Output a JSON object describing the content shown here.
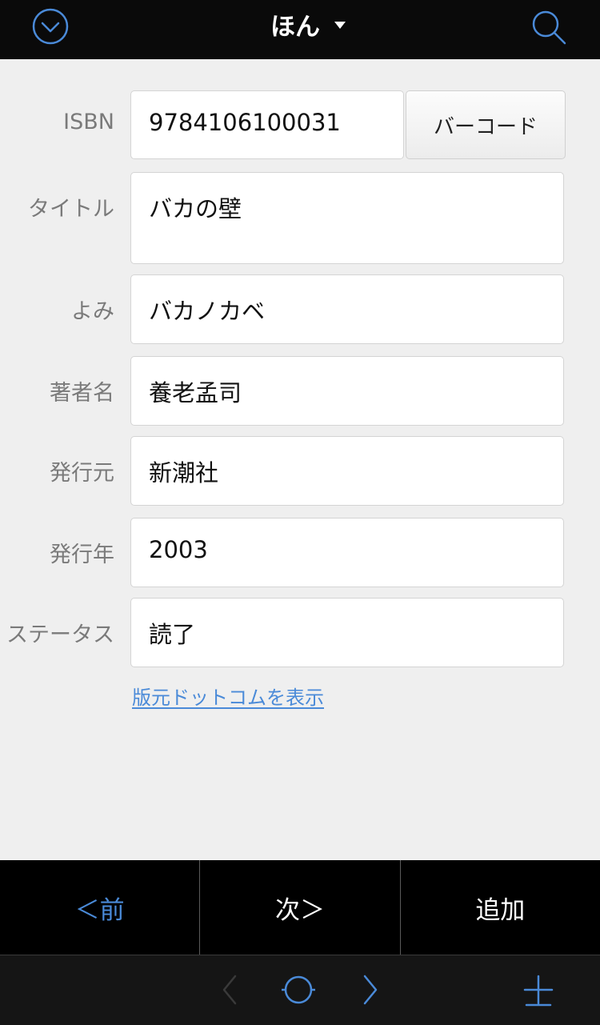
{
  "header": {
    "title": "ほん",
    "left_icon": "chevron-down-circle-icon",
    "right_icon": "search-icon",
    "accent": "#4a8ad8"
  },
  "form": {
    "isbn": {
      "label": "ISBN",
      "value": "9784106100031",
      "barcode_button": "バーコード"
    },
    "title": {
      "label": "タイトル",
      "value": "バカの壁"
    },
    "yomi": {
      "label": "よみ",
      "value": "バカノカベ"
    },
    "author": {
      "label": "著者名",
      "value": "養老孟司"
    },
    "publisher": {
      "label": "発行元",
      "value": "新潮社"
    },
    "year": {
      "label": "発行年",
      "value": "2003"
    },
    "status": {
      "label": "ステータス",
      "value": "読了"
    },
    "link": "版元ドットコムを表示"
  },
  "actions": {
    "prev": "＜前",
    "next": "次＞",
    "add": "追加"
  },
  "toolbar": {
    "icons": [
      "back-arrow-icon",
      "circle-icon",
      "forward-arrow-icon",
      "plus-icon"
    ]
  }
}
